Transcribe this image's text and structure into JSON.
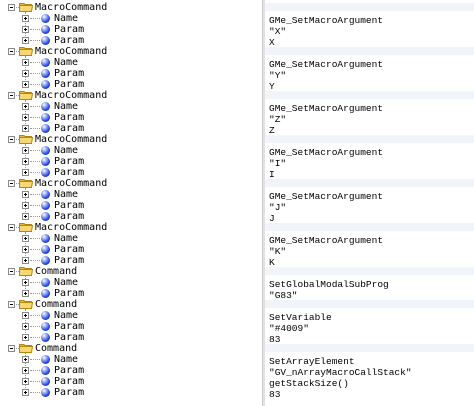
{
  "tree": {
    "groups": [
      {
        "label": "MacroCommand",
        "children": [
          "Name",
          "Param",
          "Param"
        ]
      },
      {
        "label": "MacroCommand",
        "children": [
          "Name",
          "Param",
          "Param"
        ]
      },
      {
        "label": "MacroCommand",
        "children": [
          "Name",
          "Param",
          "Param"
        ]
      },
      {
        "label": "MacroCommand",
        "children": [
          "Name",
          "Param",
          "Param"
        ]
      },
      {
        "label": "MacroCommand",
        "children": [
          "Name",
          "Param",
          "Param"
        ]
      },
      {
        "label": "MacroCommand",
        "children": [
          "Name",
          "Param",
          "Param"
        ]
      },
      {
        "label": "Command",
        "children": [
          "Name",
          "Param"
        ]
      },
      {
        "label": "Command",
        "children": [
          "Name",
          "Param",
          "Param"
        ]
      },
      {
        "label": "Command",
        "children": [
          "Name",
          "Param",
          "Param",
          "Param"
        ]
      }
    ]
  },
  "values": {
    "groups": [
      [
        "GMe_SetMacroArgument",
        "\"X\"",
        "X"
      ],
      [
        "GMe_SetMacroArgument",
        "\"Y\"",
        "Y"
      ],
      [
        "GMe_SetMacroArgument",
        "\"Z\"",
        "Z"
      ],
      [
        "GMe_SetMacroArgument",
        "\"I\"",
        "I"
      ],
      [
        "GMe_SetMacroArgument",
        "\"J\"",
        "J"
      ],
      [
        "GMe_SetMacroArgument",
        "\"K\"",
        "K"
      ],
      [
        "SetGlobalModalSubProg",
        "\"G83\""
      ],
      [
        "SetVariable",
        "\"#4009\"",
        "83"
      ],
      [
        "SetArrayElement",
        "\"GV_nArrayMacroCallStack\"",
        "getStackSize()",
        "83"
      ]
    ]
  },
  "colors": {
    "folder": "#f2c94c",
    "node_icon": "#2242d8",
    "band": "#f1f4f9"
  },
  "icons": {
    "group": "folder-icon",
    "child": "blue-ball-icon",
    "expander": "expander-plus-icon"
  }
}
